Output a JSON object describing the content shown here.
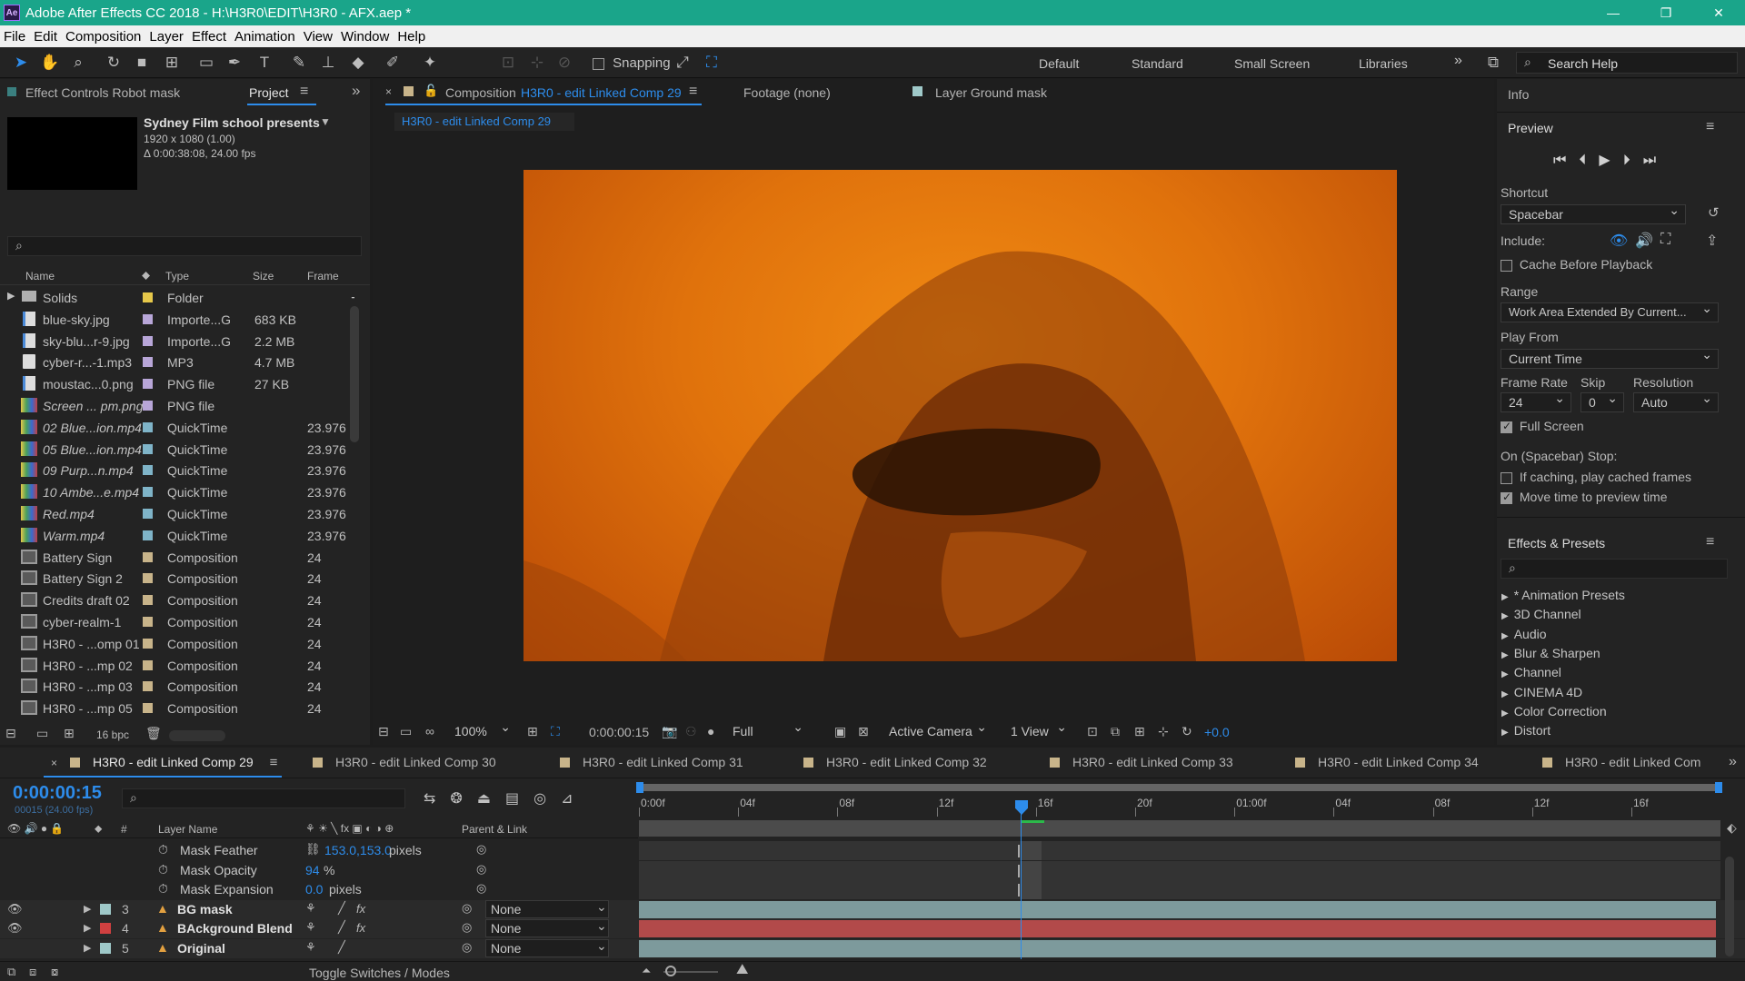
{
  "window": {
    "title": "Adobe After Effects CC 2018 - H:\\H3R0\\EDIT\\H3R0 - AFX.aep *",
    "app_icon": "Ae"
  },
  "menu": [
    "File",
    "Edit",
    "Composition",
    "Layer",
    "Effect",
    "Animation",
    "View",
    "Window",
    "Help"
  ],
  "toolbar": {
    "snapping": "Snapping",
    "workspaces": [
      "Default",
      "Standard",
      "Small Screen",
      "Libraries"
    ],
    "search_placeholder": "Search Help"
  },
  "project": {
    "tab_effect_controls": "Effect Controls Robot mask",
    "tab_project": "Project",
    "comp_name": "Sydney Film school presents",
    "comp_res": "1920 x 1080 (1.00)",
    "comp_dur": "Δ 0:00:38:08, 24.00 fps",
    "columns": {
      "name": "Name",
      "type": "Type",
      "size": "Size",
      "frame": "Frame"
    },
    "items": [
      {
        "name": "Solids",
        "type": "Folder",
        "size": "",
        "frame": "",
        "label": "#e6c84a",
        "kind": "folder",
        "italic": false
      },
      {
        "name": "blue-sky.jpg",
        "type": "Importe...G",
        "size": "683 KB",
        "frame": "",
        "label": "#b8a6d8",
        "kind": "image",
        "italic": false
      },
      {
        "name": "sky-blu...r-9.jpg",
        "type": "Importe...G",
        "size": "2.2 MB",
        "frame": "",
        "label": "#b8a6d8",
        "kind": "image",
        "italic": false
      },
      {
        "name": "cyber-r...-1.mp3",
        "type": "MP3",
        "size": "4.7 MB",
        "frame": "",
        "label": "#b8a6d8",
        "kind": "audio",
        "italic": false
      },
      {
        "name": "moustac...0.png",
        "type": "PNG file",
        "size": "27 KB",
        "frame": "",
        "label": "#b8a6d8",
        "kind": "image",
        "italic": false
      },
      {
        "name": "Screen ... pm.png",
        "type": "PNG file",
        "size": "",
        "frame": "",
        "label": "#b8a6d8",
        "kind": "video",
        "italic": true
      },
      {
        "name": "02 Blue...ion.mp4",
        "type": "QuickTime",
        "size": "",
        "frame": "23.976",
        "label": "#7fb4c8",
        "kind": "video",
        "italic": true
      },
      {
        "name": "05 Blue...ion.mp4",
        "type": "QuickTime",
        "size": "",
        "frame": "23.976",
        "label": "#7fb4c8",
        "kind": "video",
        "italic": true
      },
      {
        "name": "09 Purp...n.mp4",
        "type": "QuickTime",
        "size": "",
        "frame": "23.976",
        "label": "#7fb4c8",
        "kind": "video",
        "italic": true
      },
      {
        "name": "10 Ambe...e.mp4",
        "type": "QuickTime",
        "size": "",
        "frame": "23.976",
        "label": "#7fb4c8",
        "kind": "video",
        "italic": true
      },
      {
        "name": "Red.mp4",
        "type": "QuickTime",
        "size": "",
        "frame": "23.976",
        "label": "#7fb4c8",
        "kind": "video",
        "italic": true
      },
      {
        "name": "Warm.mp4",
        "type": "QuickTime",
        "size": "",
        "frame": "23.976",
        "label": "#7fb4c8",
        "kind": "video",
        "italic": true
      },
      {
        "name": "Battery Sign",
        "type": "Composition",
        "size": "",
        "frame": "24",
        "label": "#c8b48a",
        "kind": "comp",
        "italic": false
      },
      {
        "name": "Battery Sign 2",
        "type": "Composition",
        "size": "",
        "frame": "24",
        "label": "#c8b48a",
        "kind": "comp",
        "italic": false
      },
      {
        "name": "Credits draft 02",
        "type": "Composition",
        "size": "",
        "frame": "24",
        "label": "#c8b48a",
        "kind": "comp",
        "italic": false
      },
      {
        "name": "cyber-realm-1",
        "type": "Composition",
        "size": "",
        "frame": "24",
        "label": "#c8b48a",
        "kind": "comp",
        "italic": false
      },
      {
        "name": "H3R0 - ...omp 01",
        "type": "Composition",
        "size": "",
        "frame": "24",
        "label": "#c8b48a",
        "kind": "comp",
        "italic": false
      },
      {
        "name": "H3R0 - ...mp 02",
        "type": "Composition",
        "size": "",
        "frame": "24",
        "label": "#c8b48a",
        "kind": "comp",
        "italic": false
      },
      {
        "name": "H3R0 - ...mp 03",
        "type": "Composition",
        "size": "",
        "frame": "24",
        "label": "#c8b48a",
        "kind": "comp",
        "italic": false
      },
      {
        "name": "H3R0 - ...mp 05",
        "type": "Composition",
        "size": "",
        "frame": "24",
        "label": "#c8b48a",
        "kind": "comp",
        "italic": false
      }
    ],
    "bpc": "16 bpc"
  },
  "viewer": {
    "tab_comp_prefix": "Composition",
    "tab_comp_name": "H3R0 - edit Linked Comp 29",
    "tab_footage": "Footage (none)",
    "tab_layer": "Layer  Ground mask",
    "breadcrumb": "H3R0 - edit Linked Comp 29",
    "zoom": "100%",
    "timecode": "0:00:00:15",
    "resolution": "Full",
    "camera": "Active Camera",
    "views": "1 View",
    "exposure": "+0.0"
  },
  "right": {
    "info": "Info",
    "preview": "Preview",
    "shortcut_label": "Shortcut",
    "shortcut": "Spacebar",
    "include": "Include:",
    "cache": "Cache Before Playback",
    "range_label": "Range",
    "range": "Work Area Extended By Current...",
    "playfrom_label": "Play From",
    "playfrom": "Current Time",
    "framerate_label": "Frame Rate",
    "skip_label": "Skip",
    "resolution_label": "Resolution",
    "framerate": "24",
    "skip": "0",
    "resolution": "Auto",
    "fullscreen": "Full Screen",
    "onstop": "On (Spacebar) Stop:",
    "ifcaching": "If caching, play cached frames",
    "movetime": "Move time to preview time",
    "effects": "Effects & Presets",
    "fx_items": [
      "* Animation Presets",
      "3D Channel",
      "Audio",
      "Blur & Sharpen",
      "Channel",
      "CINEMA 4D",
      "Color Correction",
      "Distort"
    ]
  },
  "timeline": {
    "tabs": [
      "H3R0 - edit Linked Comp 29",
      "H3R0 - edit Linked Comp 30",
      "H3R0 - edit Linked Comp 31",
      "H3R0 - edit Linked Comp 32",
      "H3R0 - edit Linked Comp 33",
      "H3R0 - edit Linked Comp 34",
      "H3R0 - edit Linked Com"
    ],
    "tab_colors": [
      "#c8b48a",
      "#c8b48a",
      "#c8b48a",
      "#c8b48a",
      "#c8b48a",
      "#c8b48a",
      "#c8b48a"
    ],
    "timecode": "0:00:00:15",
    "frames": "00015 (24.00 fps)",
    "col_num": "#",
    "col_layer": "Layer Name",
    "col_parent": "Parent & Link",
    "ruler": [
      "0:00f",
      "04f",
      "08f",
      "12f",
      "16f",
      "20f",
      "01:00f",
      "04f",
      "08f",
      "12f",
      "16f"
    ],
    "props": [
      {
        "name": "Mask Feather",
        "value": "153.0,153.0",
        "unit": "pixels",
        "link": true
      },
      {
        "name": "Mask Opacity",
        "value": "94",
        "unit": "%",
        "link": false
      },
      {
        "name": "Mask Expansion",
        "value": "0.0",
        "unit": "pixels",
        "link": false
      }
    ],
    "layers": [
      {
        "num": "3",
        "name": "BG mask",
        "label": "#9fc9c9",
        "fx": true,
        "parent": "None",
        "bar": "#7d9a9c",
        "eye": true
      },
      {
        "num": "4",
        "name": "BAckground Blend",
        "label": "#d04040",
        "fx": true,
        "parent": "None",
        "bar": "#b24a4a",
        "eye": true
      },
      {
        "num": "5",
        "name": "Original",
        "label": "#9fc9c9",
        "fx": false,
        "parent": "None",
        "bar": "#7d9a9c",
        "eye": false
      }
    ],
    "toggle": "Toggle Switches / Modes"
  }
}
